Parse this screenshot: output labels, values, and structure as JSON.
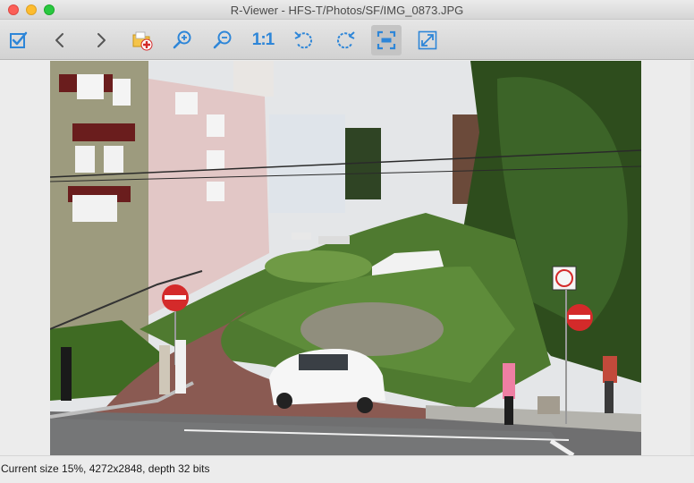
{
  "window": {
    "title": "R-Viewer - HFS-T/Photos/SF/IMG_0873.JPG"
  },
  "toolbar": {
    "buttons": [
      {
        "name": "select-checkbox",
        "icon": "checkbox-icon"
      },
      {
        "name": "previous",
        "icon": "chevron-left-icon"
      },
      {
        "name": "next",
        "icon": "chevron-right-icon"
      },
      {
        "name": "recover-file",
        "icon": "folder-recover-icon"
      },
      {
        "name": "zoom-in",
        "icon": "zoom-in-icon"
      },
      {
        "name": "zoom-out",
        "icon": "zoom-out-icon"
      },
      {
        "name": "actual-size",
        "icon": "actual-size-icon",
        "label": "1:1"
      },
      {
        "name": "rotate-left",
        "icon": "rotate-ccw-icon"
      },
      {
        "name": "rotate-right",
        "icon": "rotate-cw-icon"
      },
      {
        "name": "fit-to-window",
        "icon": "fit-window-icon"
      },
      {
        "name": "fullscreen",
        "icon": "expand-icon"
      }
    ],
    "actual_size_label": "1:1"
  },
  "colors": {
    "accent": "#2e86d8",
    "toolbar_bg": "#dcdcdc"
  },
  "status": {
    "text": "Current size 15%, 4272x2848, depth 32 bits"
  }
}
